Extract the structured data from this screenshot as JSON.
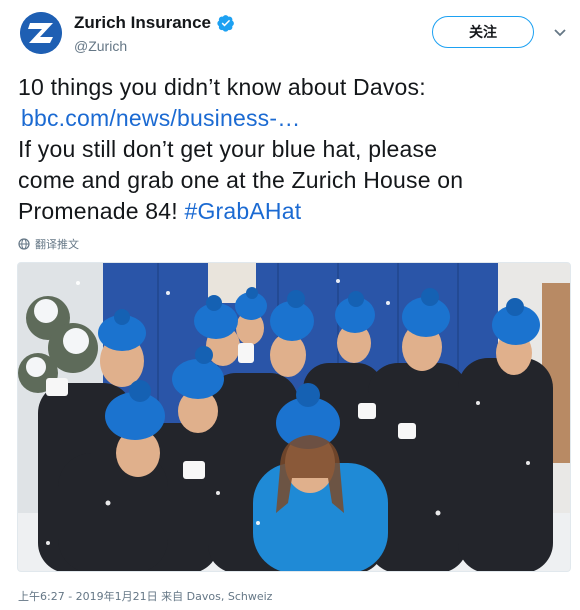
{
  "account": {
    "display_name": "Zurich Insurance",
    "handle": "@Zurich",
    "verified": true,
    "follow_label": "关注",
    "brand_color": "#1e5fb3"
  },
  "tweet": {
    "line1": "10 things you didn’t know about Davos:",
    "link": "bbc.com/news/business-…",
    "line3": "If you still don’t get your blue hat, please",
    "line4": "come and grab one at the Zurich House on",
    "line5_text": "Promenade 84! ",
    "hashtag": "#GrabAHat",
    "link_color": "#1b6ad2"
  },
  "translate": {
    "label": "翻译推文",
    "icon": "globe-icon"
  },
  "media": {
    "type": "photo",
    "description_icon": "photo-group-blue-hats"
  },
  "footer": {
    "time": "上午6:27",
    "separator": " - ",
    "date": "2019年1月21日",
    "from_label": " 来自 ",
    "place": "Davos, Schweiz"
  }
}
